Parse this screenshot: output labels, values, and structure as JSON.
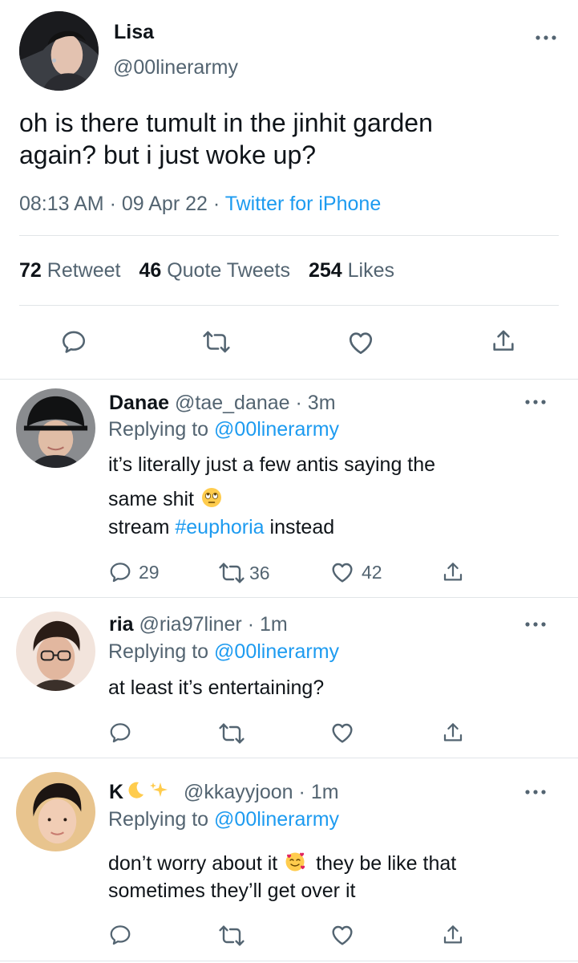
{
  "main_tweet": {
    "author_name": "Lisa",
    "author_handle": "@00linerarmy",
    "text_line1": "oh is there tumult in the jinhit garden",
    "text_line2": "again? but i just woke up?",
    "time": "08:13 AM",
    "date": "09 Apr 22",
    "source": "Twitter for iPhone",
    "retweets_count": "72",
    "retweets_label": "Retweet",
    "quotes_count": "46",
    "quotes_label": "Quote Tweets",
    "likes_count": "254",
    "likes_label": "Likes"
  },
  "replies": [
    {
      "name": "Danae",
      "handle": "@tae_danae",
      "time": "3m",
      "replying_label": "Replying to",
      "replying_handle": "@00linerarmy",
      "text_line1": "it’s literally just a few antis saying the",
      "text_line2_a": "same shit",
      "text_line3_a": "stream",
      "hashtag": "#euphoria",
      "text_line3_b": "instead",
      "reply_count": "29",
      "retweet_count": "36",
      "like_count": "42"
    },
    {
      "name": "ria",
      "handle": "@ria97liner",
      "time": "1m",
      "replying_label": "Replying to",
      "replying_handle": "@00linerarmy",
      "text_line1": "at least it’s entertaining?"
    },
    {
      "name": "K",
      "handle": "@kkayyjoon",
      "time": "1m",
      "replying_label": "Replying to",
      "replying_handle": "@00linerarmy",
      "text_line1_a": "don’t worry about it",
      "text_line1_b": "they be like that",
      "text_line2": "sometimes they’ll get over it"
    }
  ],
  "separators": {
    "dot": "·"
  },
  "icons": {
    "reply": "speech-bubble-icon",
    "retweet": "retweet-arrows-icon",
    "like": "heart-icon",
    "share": "share-upload-icon",
    "more": "three-dots-icon",
    "emoji_eyeroll": "face-rolling-eyes-icon",
    "emoji_hearts": "smiling-face-with-hearts-icon",
    "emoji_moon": "crescent-moon-icon",
    "emoji_sparkles": "sparkles-icon"
  },
  "colors": {
    "link_blue": "#1d9bf0",
    "secondary_gray": "#536471",
    "text": "#0f1419",
    "divider": "#e1e5e8"
  }
}
